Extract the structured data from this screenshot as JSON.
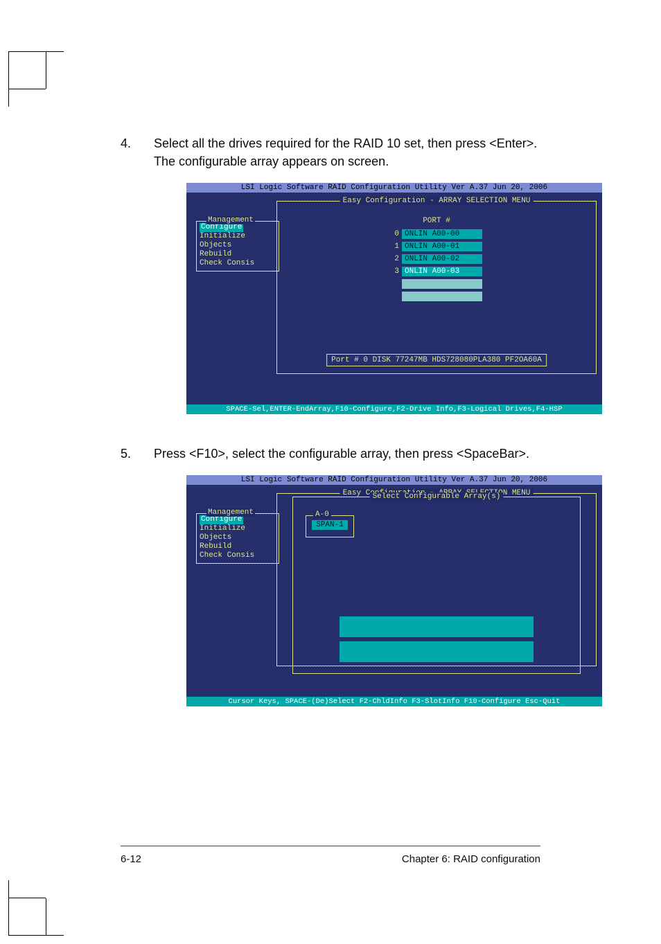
{
  "footer": {
    "page_label": "6-12",
    "chapter_label": "Chapter 6: RAID configuration"
  },
  "step4": {
    "num": "4.",
    "text": "Select all the drives required for the RAID 10 set, then press <Enter>. The configurable array appears on screen."
  },
  "step5": {
    "num": "5.",
    "text": "Press <F10>, select the configurable array, then press <SpaceBar>."
  },
  "bios_common": {
    "title": "LSI Logic Software RAID Configuration Utility Ver A.37 Jun 20, 2006",
    "mgmt_title": "Management",
    "menu": {
      "configure": "Configure",
      "initialize": "Initialize",
      "objects": "Objects",
      "rebuild": "Rebuild",
      "check": "Check Consis"
    },
    "arrsel_title": "Easy Configuration - ARRAY SELECTION MENU"
  },
  "bios1": {
    "port_header": "PORT #",
    "drives": [
      {
        "num": "0",
        "label": "ONLIN A00-00"
      },
      {
        "num": "1",
        "label": "ONLIN A00-01"
      },
      {
        "num": "2",
        "label": "ONLIN A00-02"
      },
      {
        "num": "3",
        "label": "ONLIN A00-03"
      }
    ],
    "port_info": "Port #  0 DISK  77247MB    HDS728080PLA380     PF2OA60A",
    "keybar": "SPACE-Sel,ENTER-EndArray,F10-Configure,F2-Drive Info,F3-Logical Drives,F4-HSP"
  },
  "bios2": {
    "inner_title": "Select Configurable Array(s)",
    "span_group": "A-0",
    "span_label": "SPAN-1",
    "keybar": "Cursor Keys, SPACE-(De)Select F2-ChldInfo F3-SlotInfo F10-Configure Esc-Quit"
  }
}
